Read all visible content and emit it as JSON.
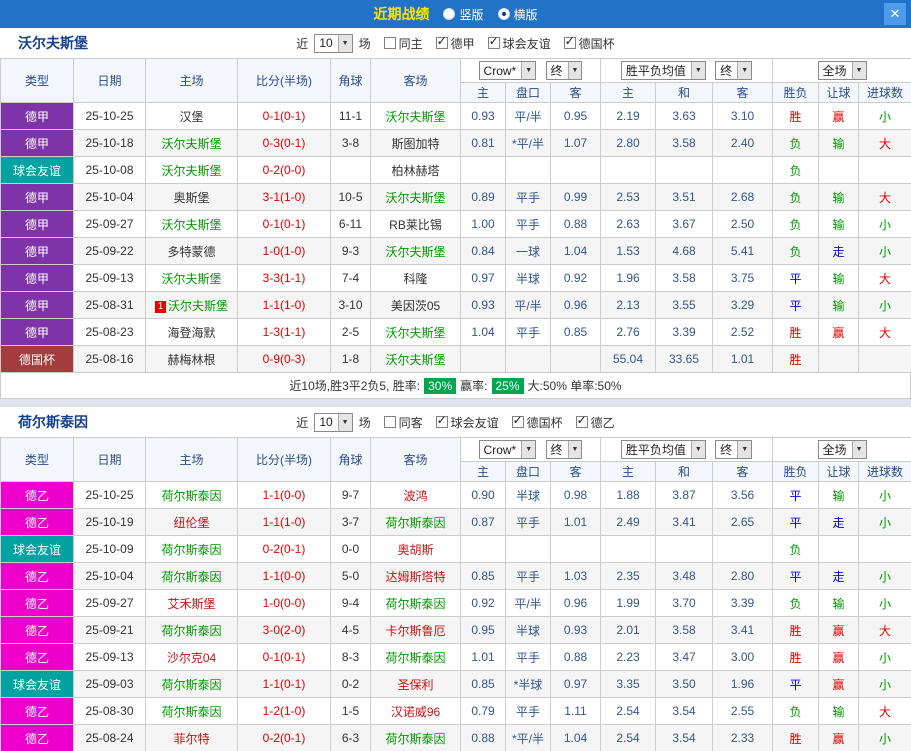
{
  "titlebar": {
    "title": "近期战绩",
    "options": [
      {
        "label": "竖版",
        "selected": false
      },
      {
        "label": "横版",
        "selected": true
      }
    ],
    "close_label": "✕"
  },
  "colors": {
    "titlebar_bg": "#2173c8",
    "title_text": "#ffe400",
    "league_bundesliga": "#7e34a8",
    "league_friendly": "#00a2a2",
    "league_cup": "#a33c3c",
    "league_bundesliga2": "#ee00cc",
    "focal_team_green": "#009900",
    "opponent_red": "#cc1111",
    "score_red": "#e60000",
    "win_red": "#e60000",
    "lose_green": "#009900",
    "draw_blue": "#0000dd",
    "rate_badge_green": "#00a650"
  },
  "sections": [
    {
      "team": "沃尔夫斯堡",
      "filter": {
        "near": "近",
        "count": "10",
        "unit": "场",
        "checkboxes": [
          {
            "label": "同主",
            "checked": false
          },
          {
            "label": "德甲",
            "checked": true
          },
          {
            "label": "球会友谊",
            "checked": true
          },
          {
            "label": "德国杯",
            "checked": true
          }
        ]
      },
      "selects": {
        "bookmaker": "Crow*",
        "asian_final": "终",
        "euro_avg": "胜平负均值",
        "euro_final": "终",
        "scope": "全场"
      },
      "headers": {
        "type": "类型",
        "date": "日期",
        "home": "主场",
        "score": "比分(半场)",
        "corner": "角球",
        "away": "客场",
        "asian_home": "主",
        "handicap": "盘口",
        "asian_away": "客",
        "euro_home": "主",
        "euro_draw": "和",
        "euro_away": "客",
        "result": "胜负",
        "handicap_result": "让球",
        "goals": "进球数"
      },
      "rows": [
        {
          "type": "德甲",
          "tc": "dejia",
          "date": "25-10-25",
          "home": "汉堡",
          "hc": "opp1",
          "badge": "",
          "score": "0-1(0-1)",
          "corner": "11-1",
          "away": "沃尔夫斯堡",
          "ac": "self",
          "h": "0.93",
          "hcap": "平/半",
          "a": "0.95",
          "e1": "2.19",
          "e2": "3.63",
          "e3": "3.10",
          "r1": "胜",
          "c1": "red",
          "r2": "赢",
          "c2": "red",
          "r3": "小",
          "c3": "green"
        },
        {
          "type": "德甲",
          "tc": "dejia",
          "date": "25-10-18",
          "home": "沃尔夫斯堡",
          "hc": "self",
          "badge": "",
          "score": "0-3(0-1)",
          "corner": "3-8",
          "away": "斯图加特",
          "ac": "opp1",
          "h": "0.81",
          "hcap": "*平/半",
          "a": "1.07",
          "e1": "2.80",
          "e2": "3.58",
          "e3": "2.40",
          "r1": "负",
          "c1": "green",
          "r2": "输",
          "c2": "green",
          "r3": "大",
          "c3": "red"
        },
        {
          "type": "球会友谊",
          "tc": "friendly",
          "date": "25-10-08",
          "home": "沃尔夫斯堡",
          "hc": "self",
          "badge": "",
          "score": "0-2(0-0)",
          "corner": "",
          "away": "柏林赫塔",
          "ac": "opp1",
          "h": "",
          "hcap": "",
          "a": "",
          "e1": "",
          "e2": "",
          "e3": "",
          "r1": "负",
          "c1": "green",
          "r2": "",
          "c2": "",
          "r3": "",
          "c3": ""
        },
        {
          "type": "德甲",
          "tc": "dejia",
          "date": "25-10-04",
          "home": "奥斯堡",
          "hc": "opp1",
          "badge": "",
          "score": "3-1(1-0)",
          "corner": "10-5",
          "away": "沃尔夫斯堡",
          "ac": "self",
          "h": "0.89",
          "hcap": "平手",
          "a": "0.99",
          "e1": "2.53",
          "e2": "3.51",
          "e3": "2.68",
          "r1": "负",
          "c1": "green",
          "r2": "输",
          "c2": "green",
          "r3": "大",
          "c3": "red"
        },
        {
          "type": "德甲",
          "tc": "dejia",
          "date": "25-09-27",
          "home": "沃尔夫斯堡",
          "hc": "self",
          "badge": "",
          "score": "0-1(0-1)",
          "corner": "6-11",
          "away": "RB莱比锡",
          "ac": "opp1",
          "h": "1.00",
          "hcap": "平手",
          "a": "0.88",
          "e1": "2.63",
          "e2": "3.67",
          "e3": "2.50",
          "r1": "负",
          "c1": "green",
          "r2": "输",
          "c2": "green",
          "r3": "小",
          "c3": "green"
        },
        {
          "type": "德甲",
          "tc": "dejia",
          "date": "25-09-22",
          "home": "多特蒙德",
          "hc": "opp1",
          "badge": "",
          "score": "1-0(1-0)",
          "corner": "9-3",
          "away": "沃尔夫斯堡",
          "ac": "self",
          "h": "0.84",
          "hcap": "一球",
          "a": "1.04",
          "e1": "1.53",
          "e2": "4.68",
          "e3": "5.41",
          "r1": "负",
          "c1": "green",
          "r2": "走",
          "c2": "blue",
          "r3": "小",
          "c3": "green"
        },
        {
          "type": "德甲",
          "tc": "dejia",
          "date": "25-09-13",
          "home": "沃尔夫斯堡",
          "hc": "self",
          "badge": "",
          "score": "3-3(1-1)",
          "corner": "7-4",
          "away": "科隆",
          "ac": "opp1",
          "h": "0.97",
          "hcap": "半球",
          "a": "0.92",
          "e1": "1.96",
          "e2": "3.58",
          "e3": "3.75",
          "r1": "平",
          "c1": "blue",
          "r2": "输",
          "c2": "green",
          "r3": "大",
          "c3": "red"
        },
        {
          "type": "德甲",
          "tc": "dejia",
          "date": "25-08-31",
          "home": "沃尔夫斯堡",
          "hc": "self",
          "badge": "1",
          "score": "1-1(1-0)",
          "corner": "3-10",
          "away": "美因茨05",
          "ac": "opp1",
          "h": "0.93",
          "hcap": "平/半",
          "a": "0.96",
          "e1": "2.13",
          "e2": "3.55",
          "e3": "3.29",
          "r1": "平",
          "c1": "blue",
          "r2": "输",
          "c2": "green",
          "r3": "小",
          "c3": "green"
        },
        {
          "type": "德甲",
          "tc": "dejia",
          "date": "25-08-23",
          "home": "海登海默",
          "hc": "opp1",
          "badge": "",
          "score": "1-3(1-1)",
          "corner": "2-5",
          "away": "沃尔夫斯堡",
          "ac": "self",
          "h": "1.04",
          "hcap": "平手",
          "a": "0.85",
          "e1": "2.76",
          "e2": "3.39",
          "e3": "2.52",
          "r1": "胜",
          "c1": "red",
          "r2": "赢",
          "c2": "red",
          "r3": "大",
          "c3": "red"
        },
        {
          "type": "德国杯",
          "tc": "cup",
          "date": "25-08-16",
          "home": "赫梅林根",
          "hc": "opp1",
          "badge": "",
          "score": "0-9(0-3)",
          "corner": "1-8",
          "away": "沃尔夫斯堡",
          "ac": "self",
          "h": "",
          "hcap": "",
          "a": "",
          "e1": "55.04",
          "e2": "33.65",
          "e3": "1.01",
          "r1": "胜",
          "c1": "red",
          "r2": "",
          "c2": "",
          "r3": "",
          "c3": ""
        }
      ],
      "footer": {
        "summary": "近10场,胜3平2负5, 胜率:",
        "win_rate": "30%",
        "odds_label": "赢率:",
        "odds_rate": "25%",
        "rest": "大:50% 单率:50%"
      }
    },
    {
      "team": "荷尔斯泰因",
      "filter": {
        "near": "近",
        "count": "10",
        "unit": "场",
        "checkboxes": [
          {
            "label": "同客",
            "checked": false
          },
          {
            "label": "球会友谊",
            "checked": true
          },
          {
            "label": "德国杯",
            "checked": true
          },
          {
            "label": "德乙",
            "checked": true
          }
        ]
      },
      "selects": {
        "bookmaker": "Crow*",
        "asian_final": "终",
        "euro_avg": "胜平负均值",
        "euro_final": "终",
        "scope": "全场"
      },
      "headers": {
        "type": "类型",
        "date": "日期",
        "home": "主场",
        "score": "比分(半场)",
        "corner": "角球",
        "away": "客场",
        "asian_home": "主",
        "handicap": "盘口",
        "asian_away": "客",
        "euro_home": "主",
        "euro_draw": "和",
        "euro_away": "客",
        "result": "胜负",
        "handicap_result": "让球",
        "goals": "进球数"
      },
      "rows": [
        {
          "type": "德乙",
          "tc": "deyi",
          "date": "25-10-25",
          "home": "荷尔斯泰因",
          "hc": "self",
          "badge": "",
          "score": "1-1(0-0)",
          "corner": "9-7",
          "away": "波鸿",
          "ac": "opp2",
          "h": "0.90",
          "hcap": "半球",
          "a": "0.98",
          "e1": "1.88",
          "e2": "3.87",
          "e3": "3.56",
          "r1": "平",
          "c1": "blue",
          "r2": "输",
          "c2": "green",
          "r3": "小",
          "c3": "green"
        },
        {
          "type": "德乙",
          "tc": "deyi",
          "date": "25-10-19",
          "home": "纽伦堡",
          "hc": "opp2",
          "badge": "",
          "score": "1-1(1-0)",
          "corner": "3-7",
          "away": "荷尔斯泰因",
          "ac": "self",
          "h": "0.87",
          "hcap": "平手",
          "a": "1.01",
          "e1": "2.49",
          "e2": "3.41",
          "e3": "2.65",
          "r1": "平",
          "c1": "blue",
          "r2": "走",
          "c2": "blue",
          "r3": "小",
          "c3": "green"
        },
        {
          "type": "球会友谊",
          "tc": "friendly",
          "date": "25-10-09",
          "home": "荷尔斯泰因",
          "hc": "self",
          "badge": "",
          "score": "0-2(0-1)",
          "corner": "0-0",
          "away": "奥胡斯",
          "ac": "opp2",
          "h": "",
          "hcap": "",
          "a": "",
          "e1": "",
          "e2": "",
          "e3": "",
          "r1": "负",
          "c1": "green",
          "r2": "",
          "c2": "",
          "r3": "",
          "c3": ""
        },
        {
          "type": "德乙",
          "tc": "deyi",
          "date": "25-10-04",
          "home": "荷尔斯泰因",
          "hc": "self",
          "badge": "",
          "score": "1-1(0-0)",
          "corner": "5-0",
          "away": "达姆斯塔特",
          "ac": "opp2",
          "h": "0.85",
          "hcap": "平手",
          "a": "1.03",
          "e1": "2.35",
          "e2": "3.48",
          "e3": "2.80",
          "r1": "平",
          "c1": "blue",
          "r2": "走",
          "c2": "blue",
          "r3": "小",
          "c3": "green"
        },
        {
          "type": "德乙",
          "tc": "deyi",
          "date": "25-09-27",
          "home": "艾禾斯堡",
          "hc": "opp2",
          "badge": "",
          "score": "1-0(0-0)",
          "corner": "9-4",
          "away": "荷尔斯泰因",
          "ac": "self",
          "h": "0.92",
          "hcap": "平/半",
          "a": "0.96",
          "e1": "1.99",
          "e2": "3.70",
          "e3": "3.39",
          "r1": "负",
          "c1": "green",
          "r2": "输",
          "c2": "green",
          "r3": "小",
          "c3": "green"
        },
        {
          "type": "德乙",
          "tc": "deyi",
          "date": "25-09-21",
          "home": "荷尔斯泰因",
          "hc": "self",
          "badge": "",
          "score": "3-0(2-0)",
          "corner": "4-5",
          "away": "卡尔斯鲁厄",
          "ac": "opp2",
          "h": "0.95",
          "hcap": "半球",
          "a": "0.93",
          "e1": "2.01",
          "e2": "3.58",
          "e3": "3.41",
          "r1": "胜",
          "c1": "red",
          "r2": "赢",
          "c2": "red",
          "r3": "大",
          "c3": "red"
        },
        {
          "type": "德乙",
          "tc": "deyi",
          "date": "25-09-13",
          "home": "沙尔克04",
          "hc": "opp2",
          "badge": "",
          "score": "0-1(0-1)",
          "corner": "8-3",
          "away": "荷尔斯泰因",
          "ac": "self",
          "h": "1.01",
          "hcap": "平手",
          "a": "0.88",
          "e1": "2.23",
          "e2": "3.47",
          "e3": "3.00",
          "r1": "胜",
          "c1": "red",
          "r2": "赢",
          "c2": "red",
          "r3": "小",
          "c3": "green"
        },
        {
          "type": "球会友谊",
          "tc": "friendly",
          "date": "25-09-03",
          "home": "荷尔斯泰因",
          "hc": "self",
          "badge": "",
          "score": "1-1(0-1)",
          "corner": "0-2",
          "away": "圣保利",
          "ac": "opp2",
          "h": "0.85",
          "hcap": "*半球",
          "a": "0.97",
          "e1": "3.35",
          "e2": "3.50",
          "e3": "1.96",
          "r1": "平",
          "c1": "blue",
          "r2": "赢",
          "c2": "red",
          "r3": "小",
          "c3": "green"
        },
        {
          "type": "德乙",
          "tc": "deyi",
          "date": "25-08-30",
          "home": "荷尔斯泰因",
          "hc": "self",
          "badge": "",
          "score": "1-2(1-0)",
          "corner": "1-5",
          "away": "汉诺威96",
          "ac": "opp2",
          "h": "0.79",
          "hcap": "平手",
          "a": "1.11",
          "e1": "2.54",
          "e2": "3.54",
          "e3": "2.55",
          "r1": "负",
          "c1": "green",
          "r2": "输",
          "c2": "green",
          "r3": "大",
          "c3": "red"
        },
        {
          "type": "德乙",
          "tc": "deyi",
          "date": "25-08-24",
          "home": "菲尔特",
          "hc": "opp2",
          "badge": "",
          "score": "0-2(0-1)",
          "corner": "6-3",
          "away": "荷尔斯泰因",
          "ac": "self",
          "h": "0.88",
          "hcap": "*平/半",
          "a": "1.04",
          "e1": "2.54",
          "e2": "3.54",
          "e3": "2.33",
          "r1": "胜",
          "c1": "red",
          "r2": "赢",
          "c2": "red",
          "r3": "小",
          "c3": "green"
        }
      ]
    }
  ]
}
